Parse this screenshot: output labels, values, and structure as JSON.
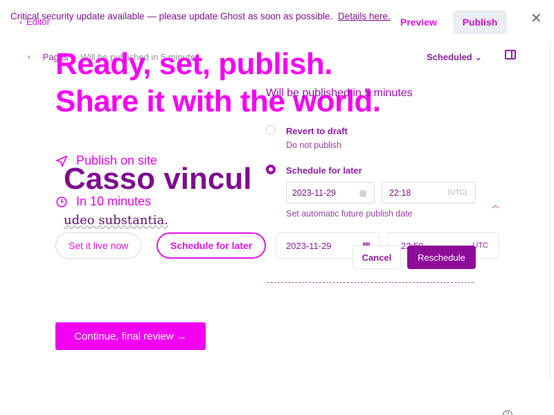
{
  "editor": {
    "back_label": "Editor",
    "breadcrumb": {
      "parent": "Pages",
      "status": "Will be published in 5 minutes"
    },
    "scheduled_label": "Scheduled",
    "post_title": "Casso vinculum",
    "post_excerpt": "udeo substantia."
  },
  "banner": {
    "message": "Critical security update available — please update Ghost as soon as possible.",
    "link": "Details here."
  },
  "topbar": {
    "preview": "Preview",
    "publish": "Publish"
  },
  "publish_flow": {
    "headline_1": "Ready, set, publish.",
    "headline_2": "Share it with the world.",
    "publish_on": "Publish on site",
    "when": "In 10 minutes",
    "set_live_now": "Set it live now",
    "schedule_for_later": "Schedule for later",
    "date": "2023-11-29",
    "time": "22:50",
    "timezone": "UTC",
    "continue": "Continue, final review →"
  },
  "schedule_popover": {
    "title": "Will be published in 5 minutes",
    "option_revert": {
      "label": "Revert to draft",
      "hint": "Do not publish"
    },
    "option_schedule": {
      "label": "Schedule for later",
      "hint": "Set automatic future publish date"
    },
    "date": "2023-11-29",
    "time": "22:18",
    "timezone": "(UTC)",
    "cancel": "Cancel",
    "reschedule": "Reschedule"
  },
  "colors": {
    "accent": "#f500f5",
    "brand_dark": "#8d0d98"
  },
  "icons": [
    "chevron-left-icon",
    "paper-plane-icon",
    "clock-icon",
    "calendar-icon",
    "close-icon",
    "sidebar-icon",
    "help-icon"
  ]
}
